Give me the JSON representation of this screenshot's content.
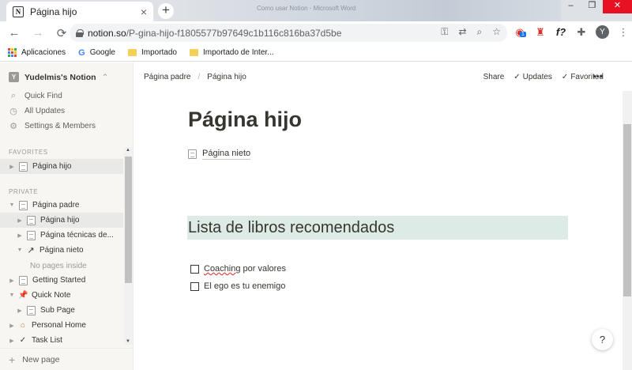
{
  "browser": {
    "tab_title": "Página hijo",
    "tab_favicon": "N",
    "tab_close": "×",
    "new_tab": "+",
    "bg_window_title": "Como usar Notion - Microsoft Word",
    "window_controls": {
      "minimize": "–",
      "restore": "❐",
      "close": "✕"
    },
    "url_host": "notion.so",
    "url_path": "/P-gina-hijo-f1805577b97649c1b116c816ba37d5be",
    "nav": {
      "back": "←",
      "forward": "→",
      "reload": "⟳"
    },
    "omnibox_icons": [
      "key-icon",
      "translate-icon",
      "zoom-icon",
      "star-icon"
    ],
    "extension_badge": "1",
    "extension_fx": "f?",
    "profile_initial": "Y",
    "menu": "⋮",
    "bookmarks": [
      {
        "label": "Aplicaciones",
        "icon": "apps-grid-icon"
      },
      {
        "label": "Google",
        "icon": "google-icon"
      },
      {
        "label": "Importado",
        "icon": "folder-icon"
      },
      {
        "label": "Importado de Inter...",
        "icon": "folder-icon"
      }
    ]
  },
  "sidebar": {
    "workspace_initial": "Y",
    "workspace_name": "Yudelmis's Notion",
    "links": {
      "quick_find": "Quick Find",
      "all_updates": "All Updates",
      "settings": "Settings & Members"
    },
    "favorites_label": "FAVORITES",
    "favorites": [
      {
        "label": "Página hijo"
      }
    ],
    "private_label": "PRIVATE",
    "pages": {
      "padre": "Página padre",
      "hijo": "Página hijo",
      "tecnicas": "Página técnicas de...",
      "nieto": "Página nieto",
      "no_pages": "No pages inside",
      "getting_started": "Getting Started",
      "quick_note": "Quick Note",
      "sub_page": "Sub Page",
      "personal_home": "Personal Home",
      "task_list": "Task List"
    },
    "new_page": "New page"
  },
  "topbar": {
    "breadcrumb": [
      "Página padre",
      "/",
      "Página hijo"
    ],
    "share": "Share",
    "updates": "Updates",
    "favorited": "Favorited",
    "more": "•••"
  },
  "page": {
    "title": "Página hijo",
    "subpage": "Página nieto",
    "heading": "Lista de libros recomendados",
    "todos": [
      {
        "word1": "Coaching",
        "rest": " por valores",
        "checked": false
      },
      {
        "text": "El ego es tu enemigo",
        "checked": false
      }
    ],
    "help": "?"
  },
  "colors": {
    "heading_bg": "#ddebe7",
    "sidebar_bg": "#f7f6f3",
    "tabbar_bg": "#dee1e6",
    "text": "#37352f"
  }
}
